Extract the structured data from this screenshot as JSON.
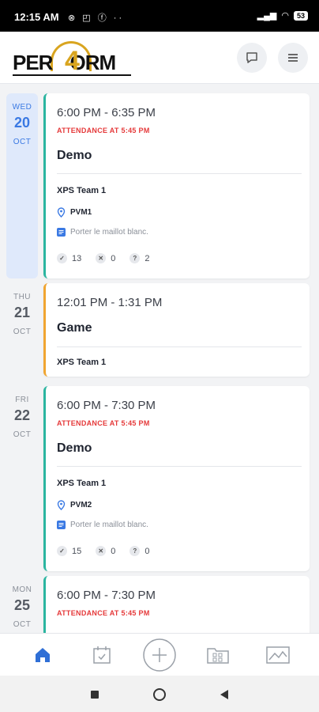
{
  "status_bar": {
    "time": "12:15 AM",
    "battery": "53"
  },
  "brand": {
    "logo_text": "PER",
    "logo_four": "4",
    "logo_text_end": "ORM",
    "accent": "#d9a520"
  },
  "colors": {
    "practice": "#2bb5a0",
    "game": "#f0a531",
    "alert": "#e5393a",
    "selected": "#3a79e3"
  },
  "days": [
    {
      "dow": "WED",
      "day": "20",
      "month": "OCT",
      "time": "6:00 PM - 6:35 PM",
      "attendance": "ATTENDANCE AT 5:45 PM",
      "title": "Demo",
      "team": "XPS Team 1",
      "location": "PVM1",
      "note": "Porter le maillot blanc.",
      "yes": "13",
      "no": "0",
      "maybe": "2"
    },
    {
      "dow": "THU",
      "day": "21",
      "month": "OCT",
      "time": "12:01 PM - 1:31 PM",
      "title": "Game",
      "team": "XPS Team 1"
    },
    {
      "dow": "FRI",
      "day": "22",
      "month": "OCT",
      "time": "6:00 PM - 7:30 PM",
      "attendance": "ATTENDANCE AT 5:45 PM",
      "title": "Demo",
      "team": "XPS Team 1",
      "location": "PVM2",
      "note": "Porter le maillot blanc.",
      "yes": "15",
      "no": "0",
      "maybe": "0"
    },
    {
      "dow": "MON",
      "day": "25",
      "month": "OCT",
      "time": "6:00 PM - 7:30 PM",
      "attendance": "ATTENDANCE AT 5:45 PM"
    }
  ],
  "nav": {
    "items": [
      "home-icon",
      "calendar-check-icon",
      "add-icon",
      "folder-grid-icon",
      "stats-chart-icon"
    ]
  }
}
